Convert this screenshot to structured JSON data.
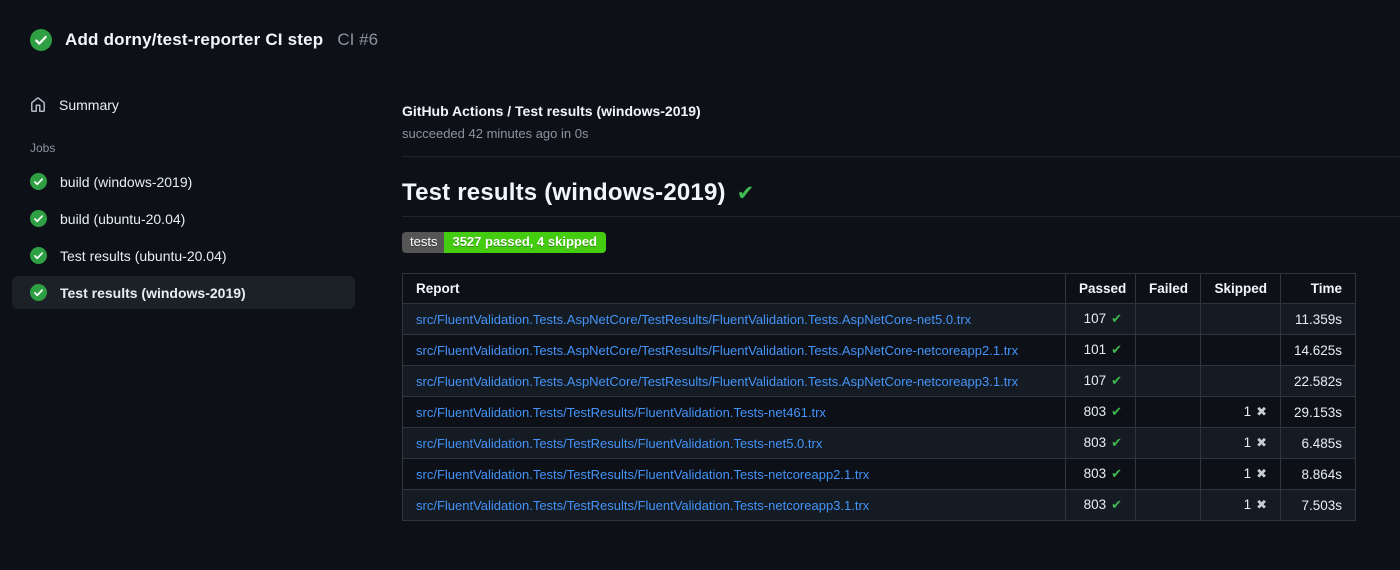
{
  "header": {
    "title": "Add dorny/test-reporter CI step",
    "run_number": "CI #6"
  },
  "sidebar": {
    "summary_label": "Summary",
    "jobs_label": "Jobs",
    "jobs": [
      {
        "label": "build (windows-2019)",
        "selected": false
      },
      {
        "label": "build (ubuntu-20.04)",
        "selected": false
      },
      {
        "label": "Test results (ubuntu-20.04)",
        "selected": false
      },
      {
        "label": "Test results (windows-2019)",
        "selected": true
      }
    ]
  },
  "main": {
    "check_run_title": "GitHub Actions / Test results (windows-2019)",
    "check_run_status": "succeeded 42 minutes ago in 0s",
    "heading": "Test results (windows-2019)",
    "heading_check": "✔",
    "badge": {
      "label": "tests",
      "value": "3527 passed, 4 skipped",
      "label_bg": "#555555",
      "value_bg": "#44cc11"
    },
    "table": {
      "headers": [
        "Report",
        "Passed",
        "Failed",
        "Skipped",
        "Time"
      ],
      "pass_icon": "✔",
      "skip_icon": "✖",
      "rows": [
        {
          "report": "src/FluentValidation.Tests.AspNetCore/TestResults/FluentValidation.Tests.AspNetCore-net5.0.trx",
          "passed": "107",
          "failed": "",
          "skipped": "",
          "time": "11.359s"
        },
        {
          "report": "src/FluentValidation.Tests.AspNetCore/TestResults/FluentValidation.Tests.AspNetCore-netcoreapp2.1.trx",
          "passed": "101",
          "failed": "",
          "skipped": "",
          "time": "14.625s"
        },
        {
          "report": "src/FluentValidation.Tests.AspNetCore/TestResults/FluentValidation.Tests.AspNetCore-netcoreapp3.1.trx",
          "passed": "107",
          "failed": "",
          "skipped": "",
          "time": "22.582s"
        },
        {
          "report": "src/FluentValidation.Tests/TestResults/FluentValidation.Tests-net461.trx",
          "passed": "803",
          "failed": "",
          "skipped": "1",
          "time": "29.153s"
        },
        {
          "report": "src/FluentValidation.Tests/TestResults/FluentValidation.Tests-net5.0.trx",
          "passed": "803",
          "failed": "",
          "skipped": "1",
          "time": "6.485s"
        },
        {
          "report": "src/FluentValidation.Tests/TestResults/FluentValidation.Tests-netcoreapp2.1.trx",
          "passed": "803",
          "failed": "",
          "skipped": "1",
          "time": "8.864s"
        },
        {
          "report": "src/FluentValidation.Tests/TestResults/FluentValidation.Tests-netcoreapp3.1.trx",
          "passed": "803",
          "failed": "",
          "skipped": "1",
          "time": "7.503s"
        }
      ]
    }
  },
  "colors": {
    "background": "#0d1117",
    "success_green": "#2ea043",
    "check_green": "#3fb950",
    "link_blue": "#4493f8",
    "muted_text": "#8b949e",
    "table_border": "#30363d",
    "row_alt": "#151b23",
    "selected_item_bg": "#1c2128"
  }
}
